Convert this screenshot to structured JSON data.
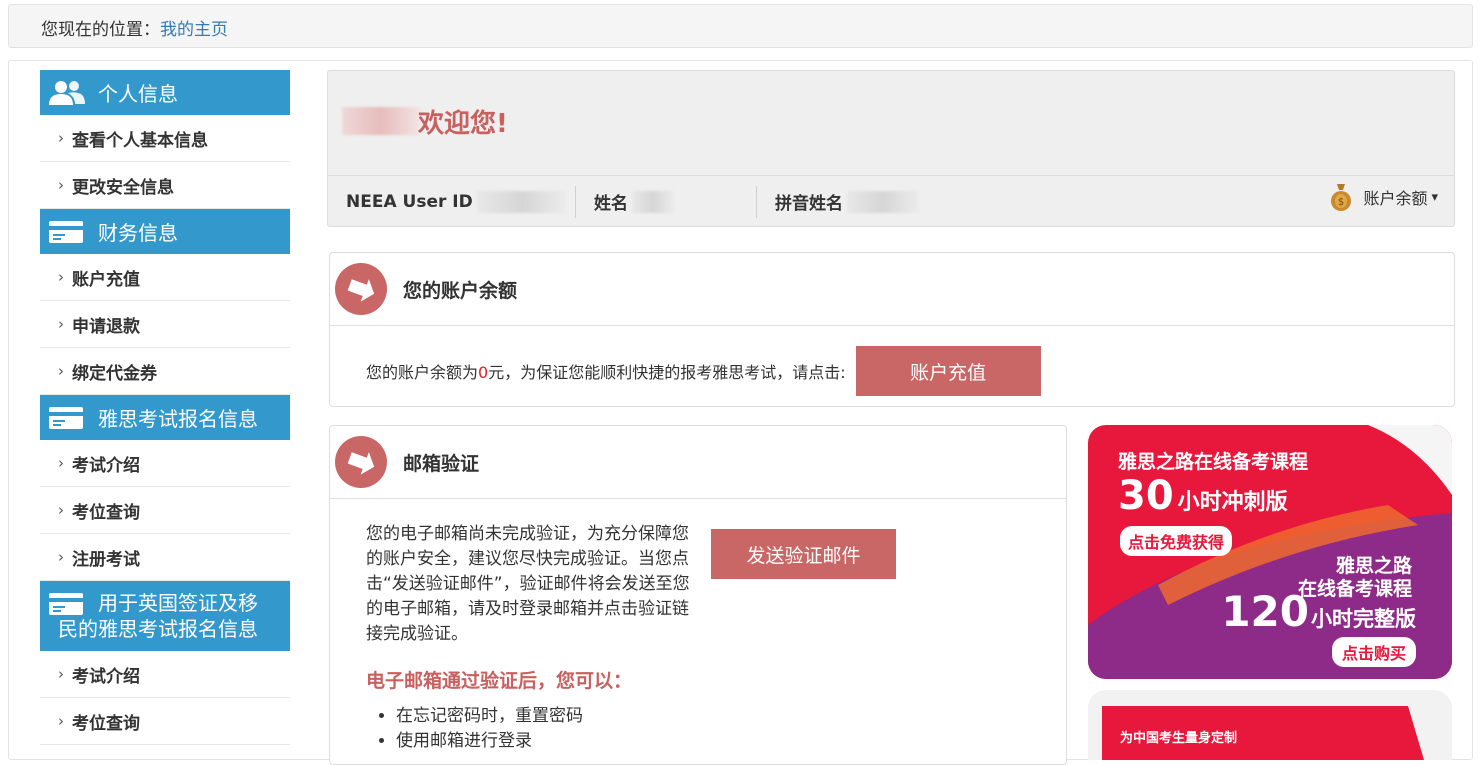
{
  "breadcrumb": {
    "label": "您现在的位置：",
    "link": "我的主页"
  },
  "sidebar": {
    "personal": {
      "title": "个人信息",
      "items": [
        "查看个人基本信息",
        "更改安全信息"
      ]
    },
    "finance": {
      "title": "财务信息",
      "items": [
        "账户充值",
        "申请退款",
        "绑定代金券"
      ]
    },
    "ielts": {
      "title": "雅思考试报名信息",
      "items": [
        "考试介绍",
        "考位查询",
        "注册考试"
      ]
    },
    "ukvi": {
      "title_line1": "用于英国签证及移",
      "title_line2": "民的雅思考试报名信息",
      "items": [
        "考试介绍",
        "考位查询"
      ]
    },
    "chevron": "›"
  },
  "welcome": {
    "greeting": "欢迎您!",
    "user_id_label": "NEEA User ID",
    "name_label": "姓名",
    "pinyin_label": "拼音姓名",
    "balance_dropdown": "账户余额",
    "caret": "▾"
  },
  "balance_panel": {
    "title": "您的账户余额",
    "text_before": "您的账户余额为",
    "amount": "0",
    "text_after": "元，为保证您能顺利快捷的报考雅思考试，请点击:",
    "button": "账户充值"
  },
  "email_panel": {
    "title": "邮箱验证",
    "description": "您的电子邮箱尚未完成验证，为充分保障您的账户安全，建议您尽快完成验证。当您点击“发送验证邮件”，验证邮件将会发送至您的电子邮箱，请及时登录邮箱并点击验证链接完成验证。",
    "button": "发送验证邮件",
    "subtitle": "电子邮箱通过验证后，您可以：",
    "bullets": [
      "在忘记密码时，重置密码",
      "使用邮箱进行登录"
    ]
  },
  "ad1": {
    "line1": "雅思之路在线备考课程",
    "hours1": "30",
    "version1": "小时冲刺版",
    "cta1": "点击免费获得",
    "line2a": "雅思之路",
    "line2b": "在线备考课程",
    "hours2": "120",
    "version2": "小时完整版",
    "cta2": "点击购买"
  },
  "ad2": {
    "text": "为中国考生量身定制"
  },
  "colors": {
    "sidebar_blue": "#3399cc",
    "accent_red": "#c96666",
    "ad_red": "#e8173c",
    "ad_purple": "#8e2a88"
  }
}
